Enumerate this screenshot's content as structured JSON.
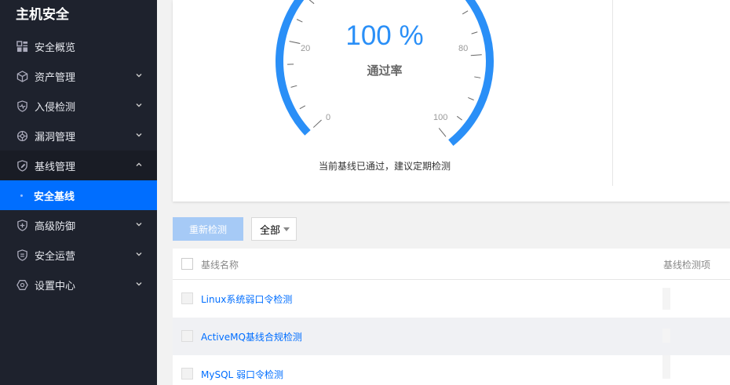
{
  "sidebar": {
    "brand": "主机安全",
    "items": [
      {
        "label": "安全概览"
      },
      {
        "label": "资产管理"
      },
      {
        "label": "入侵检测"
      },
      {
        "label": "漏洞管理"
      },
      {
        "label": "基线管理"
      },
      {
        "label": "安全基线"
      },
      {
        "label": "高级防御"
      },
      {
        "label": "安全运营"
      },
      {
        "label": "设置中心"
      }
    ]
  },
  "gauge": {
    "value": "100 %",
    "label": "通过率",
    "ticks": [
      "0",
      "20",
      "80",
      "100"
    ],
    "tip": "当前基线已通过，建议定期检测",
    "color": "#2a8ff7"
  },
  "toolbar": {
    "recheck_label": "重新检测",
    "filter_value": "全部"
  },
  "table": {
    "headers": [
      "基线名称",
      "基线检测项"
    ],
    "rows": [
      {
        "name": "Linux系统弱口令检测"
      },
      {
        "name": "ActiveMQ基线合规检测"
      },
      {
        "name": "MySQL 弱口令检测"
      }
    ]
  }
}
